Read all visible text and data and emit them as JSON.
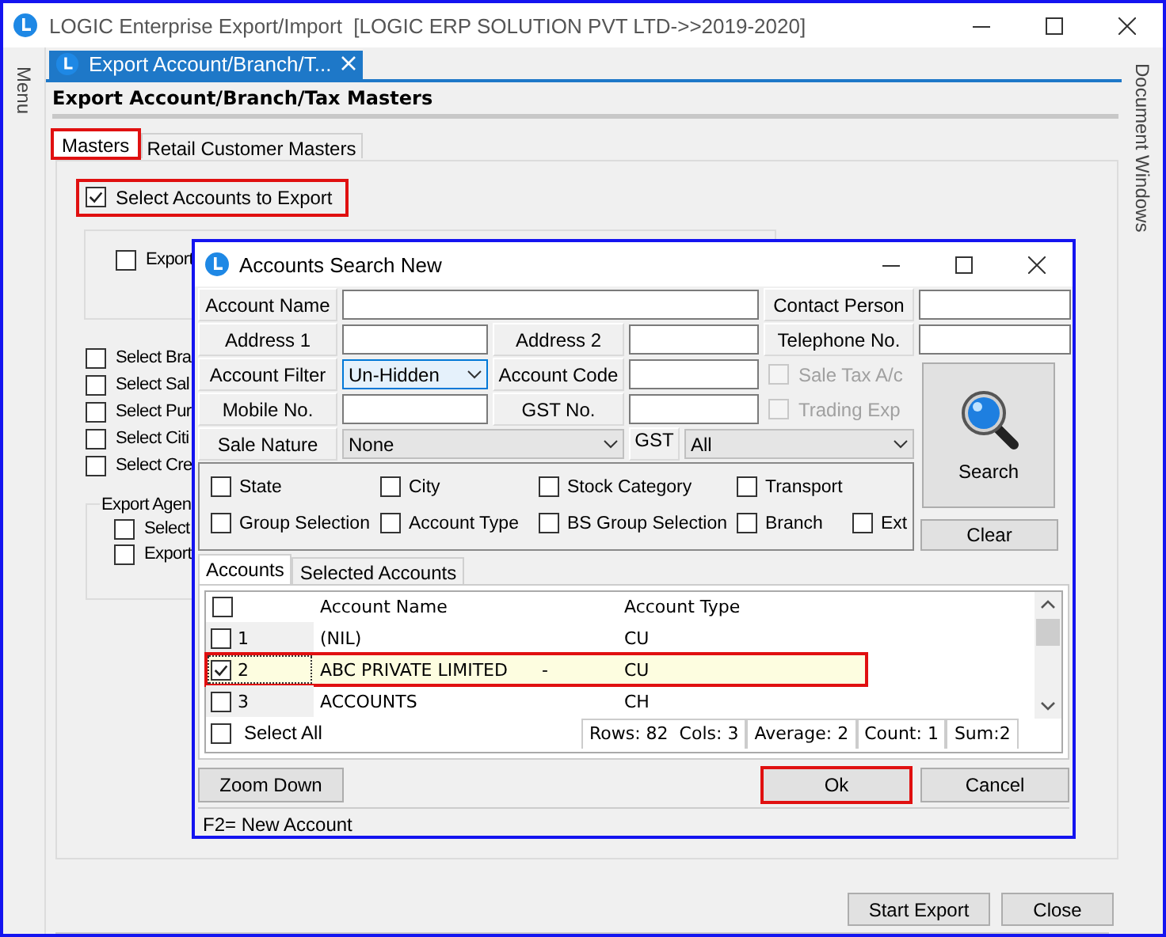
{
  "window": {
    "title": "LOGIC Enterprise Export/Import  [LOGIC ERP SOLUTION PVT LTD->>2019-2020]"
  },
  "side_panels": {
    "left": "Menu",
    "right": "Document Windows"
  },
  "document_tab": {
    "label": "Export Account/Branch/T..."
  },
  "page": {
    "heading": "Export Account/Branch/Tax Masters",
    "tabs": [
      {
        "label": "Masters",
        "selected": true,
        "highlighted": true
      },
      {
        "label": "Retail Customer Masters",
        "selected": false,
        "highlighted": false
      }
    ],
    "select_accounts": {
      "label": "Select Accounts to Export",
      "checked": true,
      "highlighted": true
    },
    "group_1": {
      "options": [
        {
          "label": "Export",
          "checked": false
        }
      ]
    },
    "options": [
      {
        "label": "Select Bra",
        "checked": false
      },
      {
        "label": "Select Sal",
        "checked": false
      },
      {
        "label": "Select Pur",
        "checked": false
      },
      {
        "label": "Select Citi",
        "checked": false
      },
      {
        "label": "Select Cre",
        "checked": false
      }
    ],
    "group_2": {
      "title": "Export Agen",
      "options": [
        {
          "label": "Select",
          "checked": false
        },
        {
          "label": "Export",
          "checked": false
        }
      ]
    },
    "buttons": [
      "Start Export",
      "Close"
    ]
  },
  "dialog": {
    "title": "Accounts Search New",
    "form": [
      {
        "kind": "text",
        "label": "Account Name"
      },
      {
        "kind": "text",
        "label": "Contact Person"
      },
      {
        "kind": "text",
        "label": "Address 1"
      },
      {
        "kind": "text",
        "label": "Address 2"
      },
      {
        "kind": "text",
        "label": "Telephone No."
      },
      {
        "kind": "select",
        "label": "Account Filter",
        "value": "Un-Hidden",
        "focused": true
      },
      {
        "kind": "text",
        "label": "Account Code"
      },
      {
        "kind": "checkbox",
        "label": "Sale Tax A/c",
        "checked": false,
        "disabled": true
      },
      {
        "kind": "text",
        "label": "Mobile No."
      },
      {
        "kind": "text",
        "label": "GST No."
      },
      {
        "kind": "checkbox",
        "label": "Trading Exp",
        "checked": false,
        "disabled": true
      },
      {
        "kind": "select",
        "label": "Sale Nature",
        "value": "None",
        "focused": false
      },
      {
        "kind": "select",
        "label": "GST",
        "value": "All",
        "focused": false
      }
    ],
    "search_button": "Search",
    "clear_button": "Clear",
    "filters": [
      [
        {
          "label": "State",
          "checked": false
        },
        {
          "label": "City",
          "checked": false
        },
        {
          "label": "Stock Category",
          "checked": false
        },
        {
          "label": "Transport",
          "checked": false
        }
      ],
      [
        {
          "label": "Group Selection",
          "checked": false
        },
        {
          "label": "Account Type",
          "checked": false
        },
        {
          "label": "BS Group Selection",
          "checked": false
        },
        {
          "label": "Branch",
          "checked": false
        },
        {
          "label": "Ext",
          "checked": false
        }
      ]
    ],
    "tabs": [
      {
        "label": "Accounts",
        "selected": true
      },
      {
        "label": "Selected Accounts",
        "selected": false
      }
    ],
    "table": {
      "header_checked": false,
      "columns": [
        "Account Name",
        "Account Type"
      ],
      "rows": [
        {
          "number": "1",
          "name": "(NIL)",
          "type": "CU",
          "checked": false,
          "selected": false,
          "highlighted": false
        },
        {
          "number": "2",
          "name": "ABC PRIVATE LIMITED",
          "mark": "-",
          "type": "CU",
          "checked": true,
          "selected": true,
          "highlighted": true
        },
        {
          "number": "3",
          "name": "ACCOUNTS",
          "type": "CH",
          "checked": false,
          "selected": false,
          "highlighted": false
        }
      ]
    },
    "select_all": {
      "label": "Select All",
      "checked": false
    },
    "stats": [
      "Rows: 82  Cols: 3",
      "Average: 2",
      "Count: 1",
      "Sum:2"
    ],
    "buttons": [
      {
        "label": "Zoom Down",
        "highlighted": false
      },
      {
        "label": "Ok",
        "highlighted": true
      },
      {
        "label": "Cancel",
        "highlighted": false
      }
    ],
    "status": "F2= New Account"
  }
}
